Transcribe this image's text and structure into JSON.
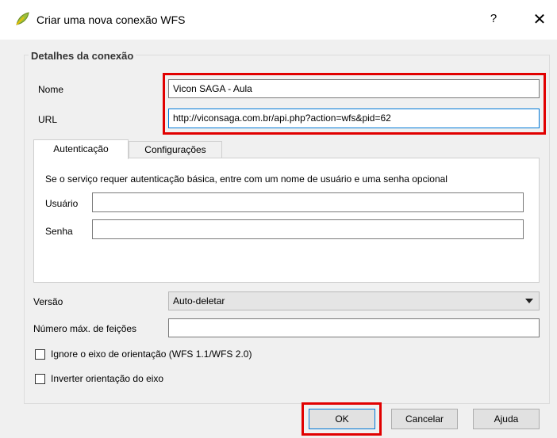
{
  "window": {
    "title": "Criar uma nova conexão WFS",
    "help_label": "?",
    "close_label": "✕"
  },
  "group": {
    "title": "Detalhes da conexão"
  },
  "fields": {
    "nome_label": "Nome",
    "nome_value": "Vicon SAGA - Aula",
    "url_label": "URL",
    "url_value": "http://viconsaga.com.br/api.php?action=wfs&pid=62"
  },
  "tabs": [
    {
      "label": "Autenticação",
      "selected": true
    },
    {
      "label": "Configurações",
      "selected": false
    }
  ],
  "auth": {
    "info": "Se o serviço requer autenticação básica, entre com um nome de usuário e uma senha opcional",
    "user_label": "Usuário",
    "user_value": "",
    "password_label": "Senha",
    "password_value": ""
  },
  "version": {
    "label": "Versão",
    "selected": "Auto-deletar"
  },
  "max_features": {
    "label": "Número máx. de feições",
    "value": ""
  },
  "checkboxes": [
    {
      "label": "Ignore o eixo de orientação (WFS 1.1/WFS 2.0)",
      "checked": false
    },
    {
      "label": "Inverter orientação do eixo",
      "checked": false
    }
  ],
  "buttons": {
    "ok": "OK",
    "cancel": "Cancelar",
    "help": "Ajuda"
  },
  "colors": {
    "highlight": "#e10000",
    "focus": "#0078d7",
    "icon_green": "#9bbf3c"
  },
  "icons": {
    "app": "qgis-leaf-icon"
  }
}
